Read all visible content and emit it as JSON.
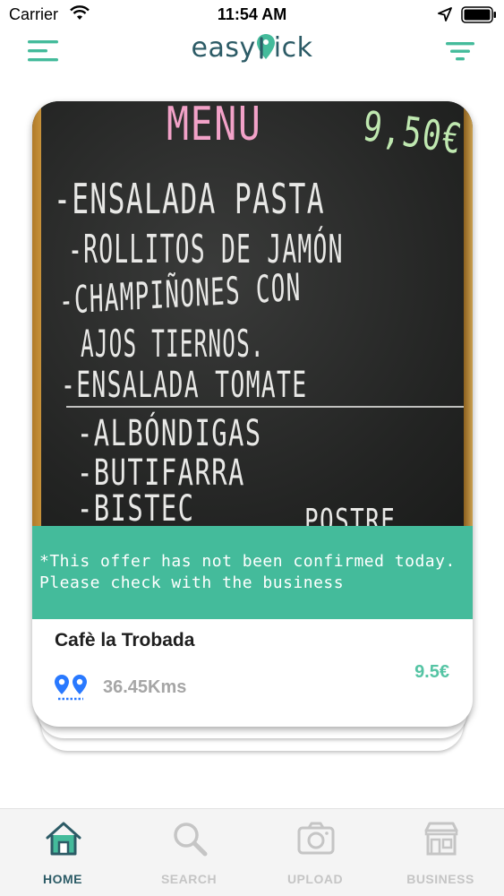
{
  "status_bar": {
    "carrier": "Carrier",
    "time": "11:54 AM"
  },
  "header": {
    "logo_prefix": "easy",
    "logo_suffix": "ick",
    "brand_color": "#2c5b66",
    "accent_color": "#44bb9b"
  },
  "card": {
    "menu_image": {
      "title": "MENU",
      "price_tag": "9,50€",
      "lines": [
        "-ENSALADA PASTA",
        "-ROLLITOS DE JAMÓN",
        "-CHAMPIÑONES CON",
        "AJOS TIERNOS.",
        "-ENSALADA TOMATE",
        "-ALBÓNDIGAS",
        "-BUTIFARRA",
        "-BISTEC",
        "POSTRE"
      ]
    },
    "notice_line1": "*This offer has not been confirmed today.",
    "notice_line2": "Please check with the business",
    "business_name": "Cafè la Trobada",
    "distance": "36.45Kms",
    "price": "9.5€"
  },
  "tabs": [
    {
      "label": "HOME",
      "icon": "home-icon",
      "active": true
    },
    {
      "label": "SEARCH",
      "icon": "search-icon",
      "active": false
    },
    {
      "label": "UPLOAD",
      "icon": "camera-icon",
      "active": false
    },
    {
      "label": "BUSINESS",
      "icon": "store-icon",
      "active": false
    }
  ]
}
